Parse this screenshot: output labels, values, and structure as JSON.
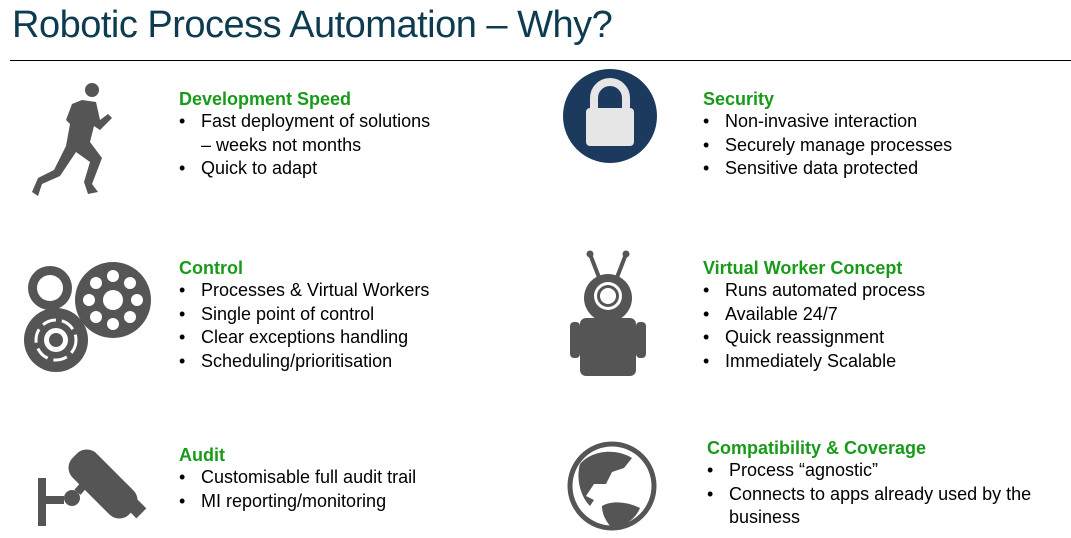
{
  "title": "Robotic Process Automation – Why?",
  "colors": {
    "title": "#0d3c51",
    "heading": "#1a9a1a",
    "icon": "#555555",
    "lock_bg": "#1c3a5e"
  },
  "sections": [
    {
      "heading": "Development Speed",
      "icon": "runner-icon",
      "bullets": [
        "Fast deployment of solutions",
        "– weeks not months",
        "Quick to adapt"
      ]
    },
    {
      "heading": "Security",
      "icon": "padlock-icon",
      "bullets": [
        "Non-invasive interaction",
        "Securely manage processes",
        "Sensitive data protected"
      ]
    },
    {
      "heading": "Control",
      "icon": "gears-icon",
      "bullets": [
        "Processes & Virtual Workers",
        "Single point of control",
        "Clear exceptions handling",
        "Scheduling/prioritisation"
      ]
    },
    {
      "heading": "Virtual Worker Concept",
      "icon": "robot-icon",
      "bullets": [
        "Runs automated process",
        "Available 24/7",
        "Quick reassignment",
        "Immediately Scalable"
      ]
    },
    {
      "heading": "Audit",
      "icon": "cctv-camera-icon",
      "bullets": [
        "Customisable full audit trail",
        "MI reporting/monitoring"
      ]
    },
    {
      "heading": "Compatibility & Coverage",
      "icon": "globe-icon",
      "bullets": [
        "Process “agnostic”",
        "Connects to apps already used by the",
        "business"
      ]
    }
  ]
}
